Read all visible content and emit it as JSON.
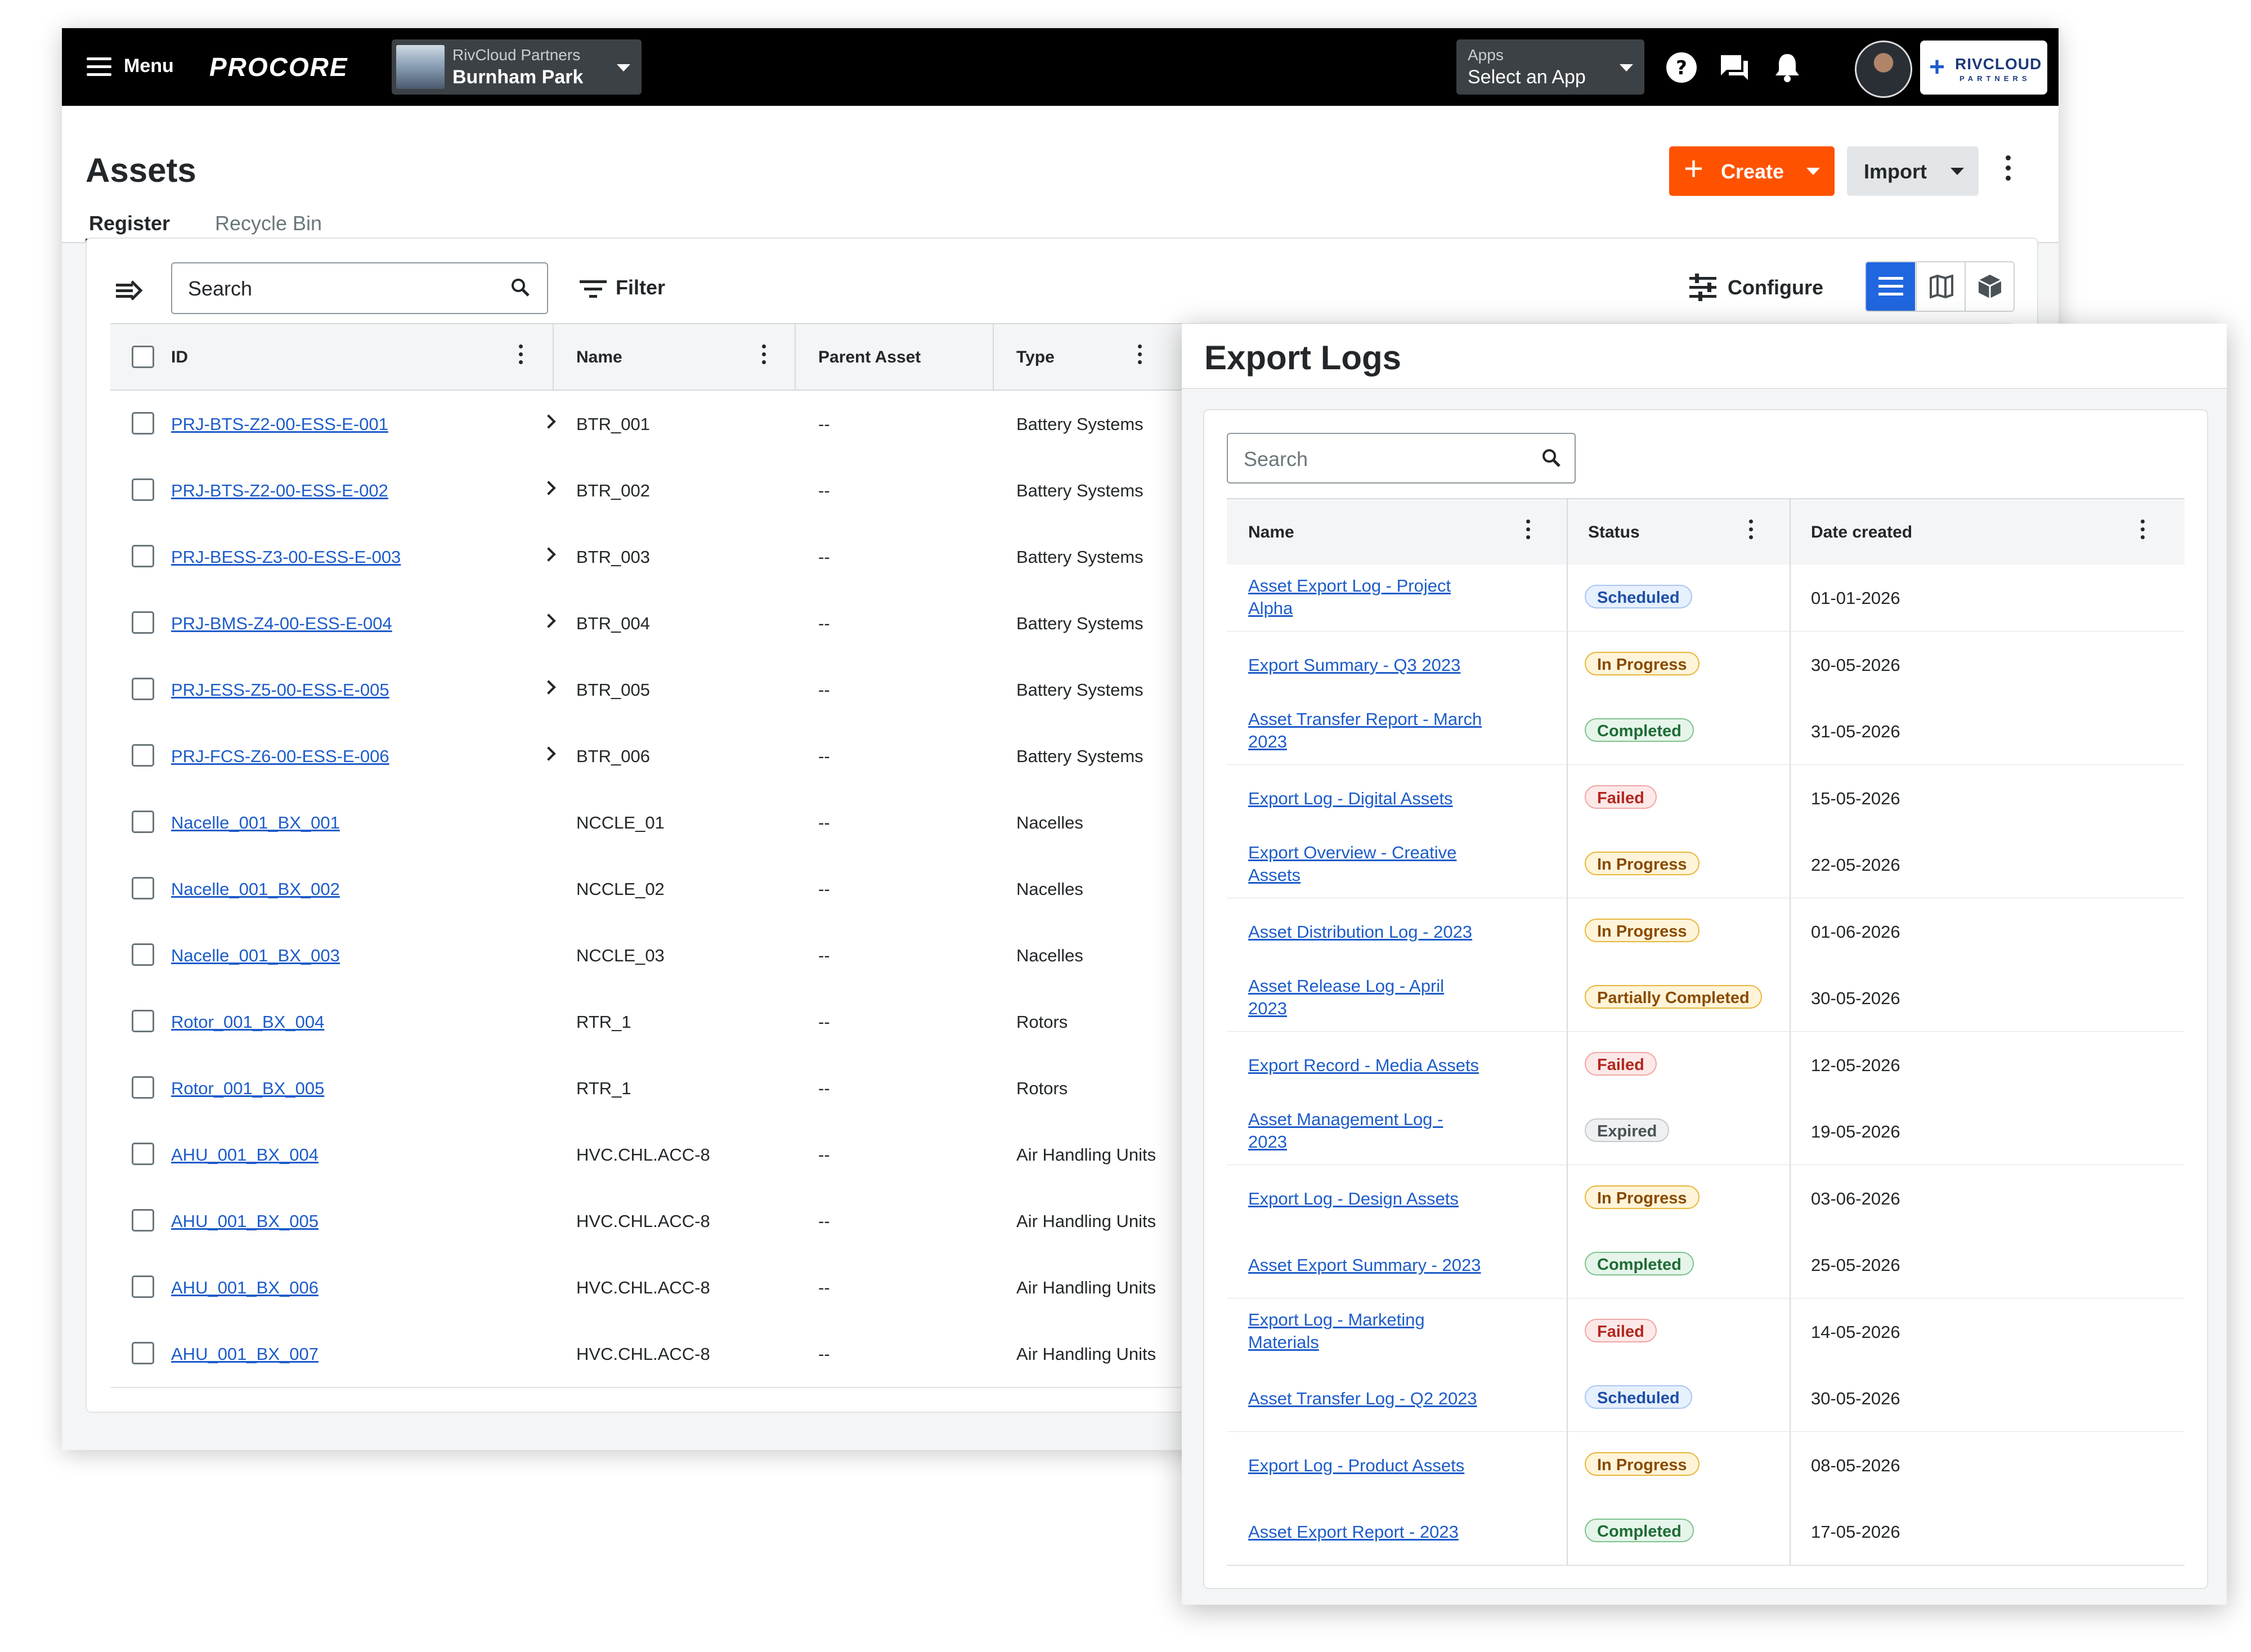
{
  "topbar": {
    "menu_label": "Menu",
    "logo": "PROCORE",
    "project_company": "RivCloud Partners",
    "project_name": "Burnham Park",
    "apps_label": "Apps",
    "apps_value": "Select an App",
    "company_logo_line1": "RIVCLOUD",
    "company_logo_line2": "PARTNERS"
  },
  "page": {
    "title": "Assets",
    "tabs": [
      {
        "label": "Register",
        "active": true
      },
      {
        "label": "Recycle Bin",
        "active": false
      }
    ],
    "create_label": "Create",
    "import_label": "Import"
  },
  "toolbar": {
    "search_placeholder": "Search",
    "filter_label": "Filter",
    "configure_label": "Configure",
    "accent_color": "#2066df"
  },
  "assets_table": {
    "columns": [
      "ID",
      "Name",
      "Parent Asset",
      "Type"
    ],
    "rows": [
      {
        "id": "PRJ-BTS-Z2-00-ESS-E-001",
        "name": "BTR_001",
        "parent": "--",
        "type": "Battery Systems",
        "expandable": true
      },
      {
        "id": "PRJ-BTS-Z2-00-ESS-E-002",
        "name": "BTR_002",
        "parent": "--",
        "type": "Battery Systems",
        "expandable": true
      },
      {
        "id": "PRJ-BESS-Z3-00-ESS-E-003",
        "name": "BTR_003",
        "parent": "--",
        "type": "Battery Systems",
        "expandable": true
      },
      {
        "id": "PRJ-BMS-Z4-00-ESS-E-004",
        "name": "BTR_004",
        "parent": "--",
        "type": "Battery Systems",
        "expandable": true
      },
      {
        "id": "PRJ-ESS-Z5-00-ESS-E-005",
        "name": "BTR_005",
        "parent": "--",
        "type": "Battery Systems",
        "expandable": true
      },
      {
        "id": "PRJ-FCS-Z6-00-ESS-E-006",
        "name": "BTR_006",
        "parent": "--",
        "type": "Battery Systems",
        "expandable": true
      },
      {
        "id": "Nacelle_001_BX_001",
        "name": "NCCLE_01",
        "parent": "--",
        "type": "Nacelles",
        "expandable": false
      },
      {
        "id": "Nacelle_001_BX_002",
        "name": "NCCLE_02",
        "parent": "--",
        "type": "Nacelles",
        "expandable": false
      },
      {
        "id": "Nacelle_001_BX_003",
        "name": "NCCLE_03",
        "parent": "--",
        "type": "Nacelles",
        "expandable": false
      },
      {
        "id": "Rotor_001_BX_004",
        "name": "RTR_1",
        "parent": "--",
        "type": "Rotors",
        "expandable": false
      },
      {
        "id": "Rotor_001_BX_005",
        "name": "RTR_1",
        "parent": "--",
        "type": "Rotors",
        "expandable": false
      },
      {
        "id": "AHU_001_BX_004",
        "name": "HVC.CHL.ACC-8",
        "parent": "--",
        "type": "Air Handling Units",
        "expandable": false
      },
      {
        "id": "AHU_001_BX_005",
        "name": "HVC.CHL.ACC-8",
        "parent": "--",
        "type": "Air Handling Units",
        "expandable": false
      },
      {
        "id": "AHU_001_BX_006",
        "name": "HVC.CHL.ACC-8",
        "parent": "--",
        "type": "Air Handling Units",
        "expandable": false
      },
      {
        "id": "AHU_001_BX_007",
        "name": "HVC.CHL.ACC-8",
        "parent": "--",
        "type": "Air Handling Units",
        "expandable": false
      }
    ]
  },
  "export_logs": {
    "title": "Export Logs",
    "search_placeholder": "Search",
    "columns": [
      "Name",
      "Status",
      "Date created"
    ],
    "status_colors": {
      "Scheduled": {
        "bg": "#e7f0fd",
        "border": "#a9c6f2",
        "fg": "#1d4fa8"
      },
      "In Progress": {
        "bg": "#fff4d9",
        "border": "#e8b73a",
        "fg": "#8a4b00"
      },
      "Completed": {
        "bg": "#e6f5ea",
        "border": "#7fc28f",
        "fg": "#1e6b34"
      },
      "Failed": {
        "bg": "#fde8e8",
        "border": "#f0a5a5",
        "fg": "#b3261e"
      },
      "Partially Completed": {
        "bg": "#fff4d9",
        "border": "#e8b73a",
        "fg": "#8a4b00"
      },
      "Expired": {
        "bg": "#eef0f1",
        "border": "#c5cacd",
        "fg": "#4a5256"
      }
    },
    "rows": [
      {
        "name": [
          "Asset Export Log - Project",
          "Alpha"
        ],
        "status": "Scheduled",
        "date": "01-01-2026"
      },
      {
        "name": [
          "Export Summary - Q3 2023"
        ],
        "status": "In Progress",
        "date": "30-05-2026"
      },
      {
        "name": [
          "Asset Transfer Report - March",
          "2023"
        ],
        "status": "Completed",
        "date": "31-05-2026"
      },
      {
        "name": [
          "Export Log - Digital Assets"
        ],
        "status": "Failed",
        "date": "15-05-2026"
      },
      {
        "name": [
          "Export Overview - Creative",
          "Assets"
        ],
        "status": "In Progress",
        "date": "22-05-2026"
      },
      {
        "name": [
          "Asset Distribution Log - 2023"
        ],
        "status": "In Progress",
        "date": "01-06-2026"
      },
      {
        "name": [
          "Asset Release Log - April",
          "2023"
        ],
        "status": "Partially Completed",
        "date": "30-05-2026"
      },
      {
        "name": [
          "Export Record - Media Assets"
        ],
        "status": "Failed",
        "date": "12-05-2026"
      },
      {
        "name": [
          "Asset Management Log -",
          "2023"
        ],
        "status": "Expired",
        "date": "19-05-2026"
      },
      {
        "name": [
          "Export Log - Design Assets"
        ],
        "status": "In Progress",
        "date": "03-06-2026"
      },
      {
        "name": [
          "Asset Export Summary - 2023"
        ],
        "status": "Completed",
        "date": "25-05-2026"
      },
      {
        "name": [
          "Export Log - Marketing",
          "Materials"
        ],
        "status": "Failed",
        "date": "14-05-2026"
      },
      {
        "name": [
          "Asset Transfer Log - Q2 2023"
        ],
        "status": "Scheduled",
        "date": "30-05-2026"
      },
      {
        "name": [
          "Export Log - Product Assets"
        ],
        "status": "In Progress",
        "date": "08-05-2026"
      },
      {
        "name": [
          "Asset Export Report - 2023"
        ],
        "status": "Completed",
        "date": "17-05-2026"
      }
    ]
  }
}
